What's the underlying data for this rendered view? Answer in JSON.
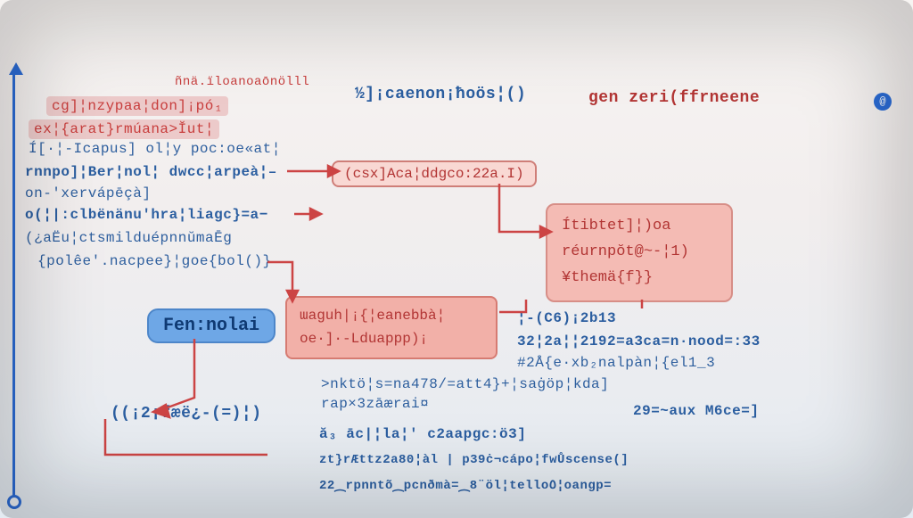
{
  "header": {
    "a": "ñnä.ïloanoaōnölll",
    "b": "½]¡caenon¡ħoös¦()",
    "c": "gen zeri(ffrneene"
  },
  "leftblock": {
    "l1": "cg]¦nzypaa¦don]¡pó₁",
    "l2": "ex¦{arat}rmúana>Ĭut¦",
    "l3": "Í[·¦-Icapus]  ol¦y poc:oe«at¦",
    "l4": "rnnpo]¦Ber¦nol¦  dwcc¦arpeà¦–",
    "l5": "on-'xervápēçà]",
    "l6": "o(¦|:clbënänu'hra¦liagc}=a−",
    "l7": "(¿aËu¦ctsmiƖduépnnŭmaĒg",
    "l8": "{polêe'.nacpee}¦goe{bol()}"
  },
  "pill": {
    "label": "Fen:nolai"
  },
  "centerbox": {
    "l1": "ɯaguh|¡{¦eanebbà¦",
    "l2": "oe·]·-Lduappp)¡"
  },
  "rightbox": {
    "l1": "Ítibtet]¦)oa",
    "l2": "réurnpŏt@~-¦1)",
    "l3": "¥themä{f}}"
  },
  "midfn": "(csx]Aca¦ddgco:22a.I)",
  "bottomleft": {
    "paren": "((¡2¡fæë¿-(=)¦)"
  },
  "rightblock": {
    "r0": "¦-(C6)¡2b13",
    "r1": "32¦2a¦¦2192=a3ca=n·nood=:33",
    "r2": "#2Å{e·xb₂nalpàn¦{el1_3",
    "r3": ">nktö¦s=na478/=att4}+¦saġöp¦kda]",
    "r4": "rap×3zāærai¤",
    "r5": "29=~aux M6ce=]",
    "r6": "ă₃  āc|¦la¦' c2aapgc:ö3]",
    "r7": "zt}rÆttz2a80¦àl | p39ċ¬cápo¦fwŮscense(]",
    "r8": "22⁔rpnntõ⁔pcnðmà=⁔8¨öl¦tello٥¦oangp="
  }
}
